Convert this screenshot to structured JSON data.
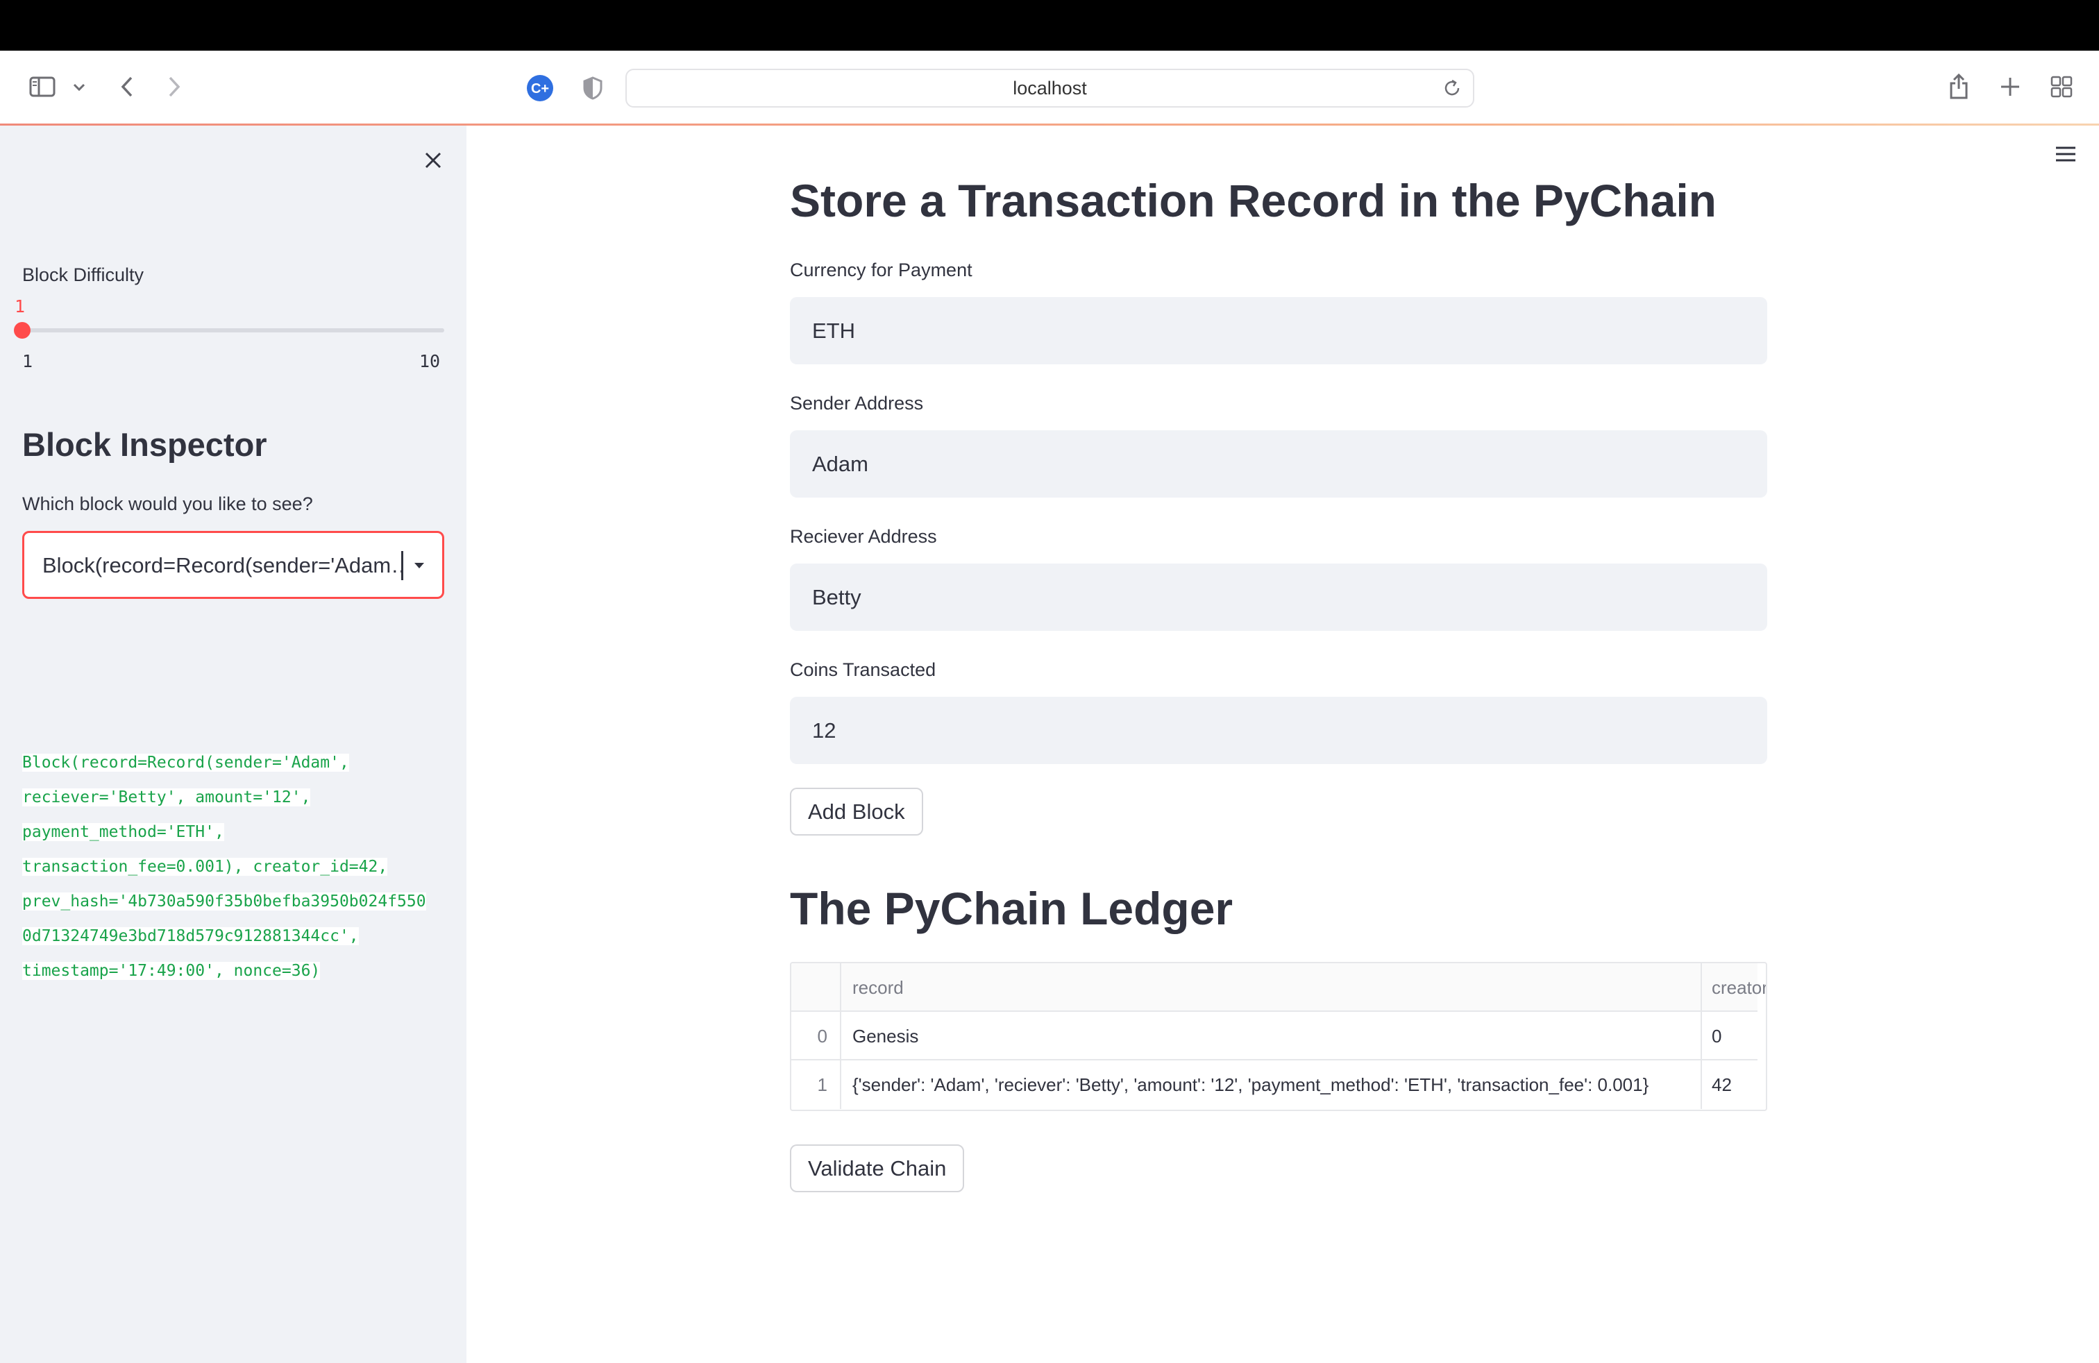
{
  "browser": {
    "url": "localhost",
    "icons": [
      "sidebar-toggle-icon",
      "chevron-down-icon",
      "back-icon",
      "forward-icon",
      "extension-icon",
      "shield-icon",
      "reload-icon",
      "share-icon",
      "new-tab-icon",
      "tab-overview-icon"
    ]
  },
  "sidebar": {
    "difficulty_label": "Block Difficulty",
    "slider": {
      "value": "1",
      "min": "1",
      "max": "10",
      "fraction": 0.0
    },
    "inspector_title": "Block Inspector",
    "select_label": "Which block would you like to see?",
    "select_value": "Block(record=Record(sender='Adam…",
    "code_lines": [
      "Block(record=Record(sender='Adam',",
      "reciever='Betty', amount='12',",
      "payment_method='ETH',",
      "transaction_fee=0.001), creator_id=42,",
      "prev_hash='4b730a590f35b0befba3950b024f550",
      "0d71324749e3bd718d579c912881344cc',",
      "timestamp='17:49:00', nonce=36)"
    ]
  },
  "main": {
    "title": "Store a Transaction Record in the PyChain",
    "fields": {
      "currency": {
        "label": "Currency for Payment",
        "value": "ETH"
      },
      "sender": {
        "label": "Sender Address",
        "value": "Adam"
      },
      "receiver": {
        "label": "Reciever Address",
        "value": "Betty"
      },
      "coins": {
        "label": "Coins Transacted",
        "value": "12"
      }
    },
    "add_block_label": "Add Block",
    "ledger_title": "The PyChain Ledger",
    "ledger": {
      "columns": [
        "record",
        "creator_i"
      ],
      "rows": [
        {
          "index": "0",
          "record": "Genesis",
          "creator_id": "0"
        },
        {
          "index": "1",
          "record": "{'sender': 'Adam', 'reciever': 'Betty', 'amount': '12', 'payment_method': 'ETH', 'transaction_fee': 0.001}",
          "creator_id": "42"
        }
      ]
    },
    "validate_label": "Validate Chain"
  }
}
